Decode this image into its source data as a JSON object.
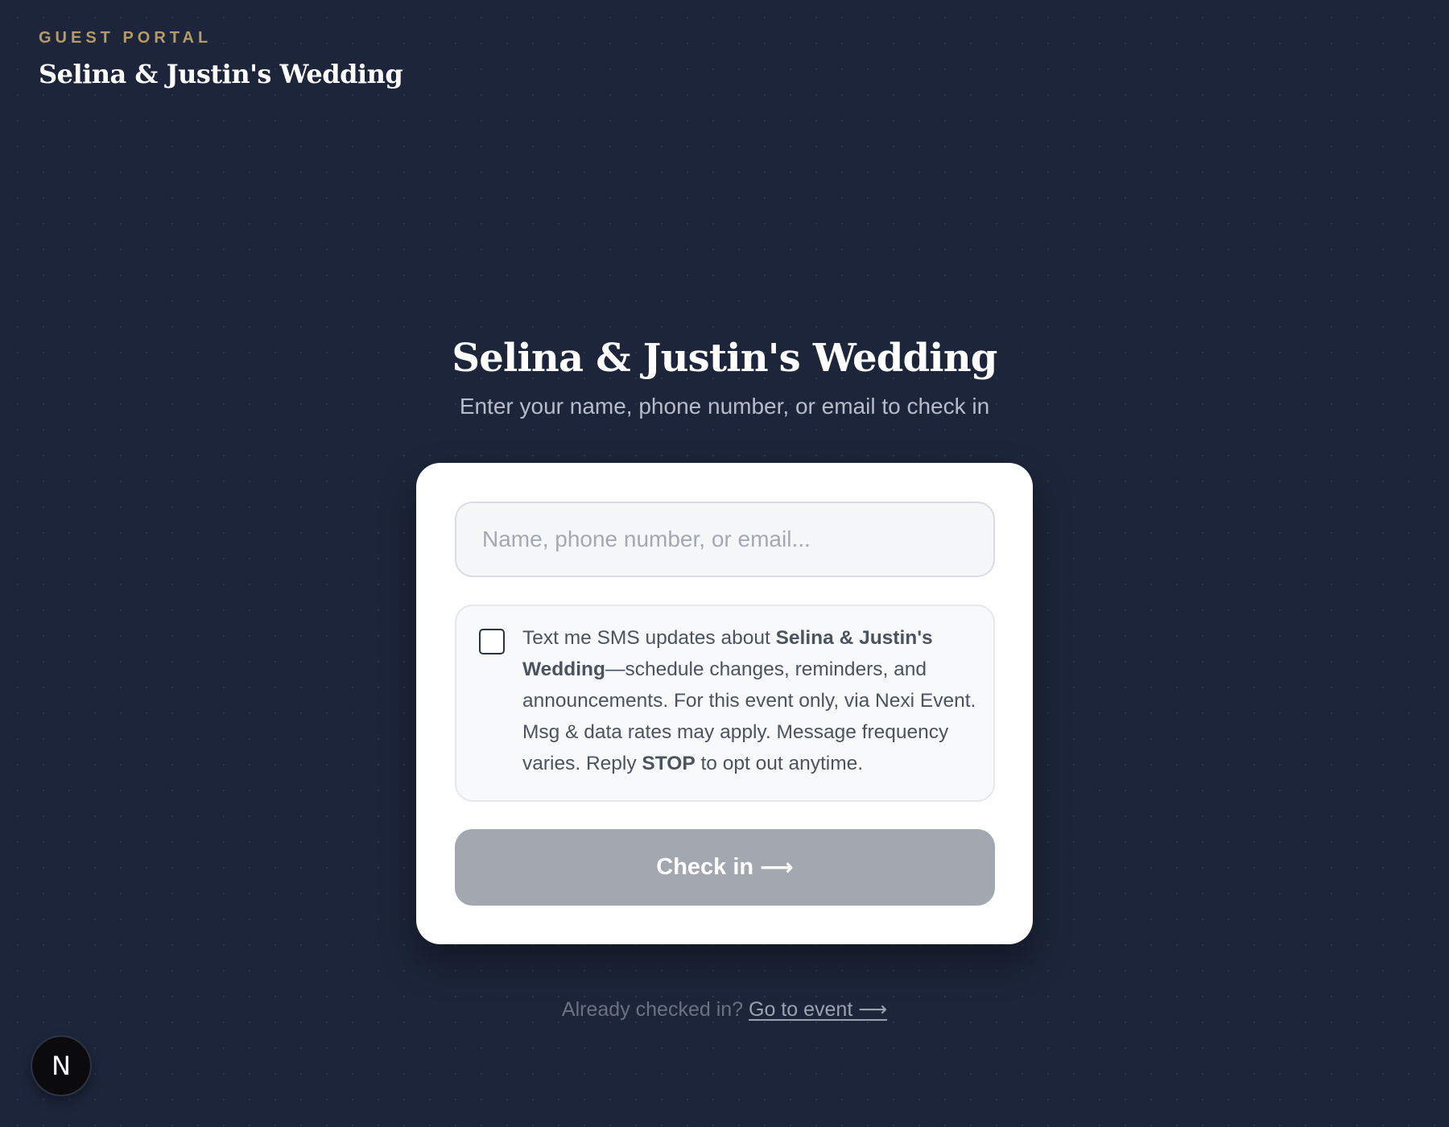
{
  "header": {
    "eyebrow": "GUEST PORTAL",
    "title": "Selina & Justin's Wedding"
  },
  "hero": {
    "title": "Selina & Justin's Wedding",
    "subtitle": "Enter your name, phone number, or email to check in"
  },
  "form": {
    "search_placeholder": "Name, phone number, or email...",
    "search_value": "",
    "sms_consent": {
      "checked": false,
      "text_before": "Text me SMS updates about ",
      "event_name": "Selina & Justin's Wedding",
      "text_middle": "—schedule changes, reminders, and announcements. For this event only, via Nexi Event. Msg & data rates may apply. Message frequency varies. Reply ",
      "stop_keyword": "STOP",
      "text_after": " to opt out anytime."
    },
    "submit_label": "Check in",
    "submit_arrow": "⟶"
  },
  "footer": {
    "prompt": "Already checked in?",
    "link_label": "Go to event ⟶"
  },
  "badge": {
    "letter": "N"
  },
  "colors": {
    "background": "#1c253a",
    "accent_gold": "#b59a6a",
    "button_disabled": "#a3a7b0",
    "card": "#ffffff"
  }
}
